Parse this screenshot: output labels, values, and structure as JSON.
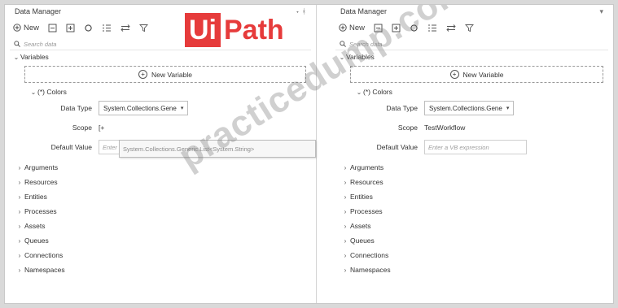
{
  "watermark": {
    "logo_ui": "Ui",
    "logo_path": "Path",
    "text": "practicedump.com"
  },
  "colors": {
    "logo_red": "#e63b3b"
  },
  "left": {
    "title": "Data Manager",
    "pin": "▾ ᚼ",
    "toolbar": {
      "new_label": "New"
    },
    "search_placeholder": "Search data",
    "variables_label": "Variables",
    "new_variable_label": "New Variable",
    "variable_label": "(*) Colors",
    "props": {
      "data_type_label": "Data Type",
      "data_type_value": "System.Collections.Gene",
      "scope_label": "Scope",
      "scope_value": "[+",
      "default_label": "Default Value",
      "default_placeholder": "Enter a VB expression"
    },
    "dropdown_text": "System.Collections.Generic.List<System.String>",
    "categories": [
      "Arguments",
      "Resources",
      "Entities",
      "Processes",
      "Assets",
      "Queues",
      "Connections",
      "Namespaces"
    ]
  },
  "right": {
    "title": "Data Manager",
    "pin": "▾",
    "toolbar": {
      "new_label": "New"
    },
    "search_placeholder": "Search data",
    "variables_label": "Variables",
    "new_variable_label": "New Variable",
    "variable_label": "(*) Colors",
    "props": {
      "data_type_label": "Data Type",
      "data_type_value": "System.Collections.Gene",
      "scope_label": "Scope",
      "scope_value": "TestWorkflow",
      "default_label": "Default Value",
      "default_placeholder": "Enter a VB expression"
    },
    "categories": [
      "Arguments",
      "Resources",
      "Entities",
      "Processes",
      "Assets",
      "Queues",
      "Connections",
      "Namespaces"
    ]
  }
}
